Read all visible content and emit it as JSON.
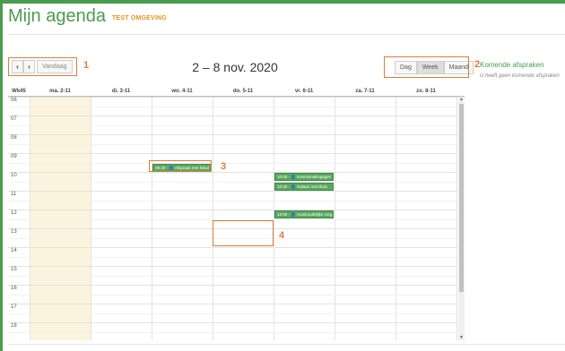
{
  "app": {
    "title": "Mijn agenda",
    "environment": "TEST OMGEVING",
    "accent": "#4a9c4e",
    "env_color": "#e8941a"
  },
  "toolbar": {
    "prev_icon": "chevron-left-icon",
    "prev_glyph": "‹",
    "next_icon": "chevron-right-icon",
    "next_glyph": "›",
    "today_label": "Vandaag",
    "date_range": "2 – 8 nov. 2020"
  },
  "views": [
    {
      "label": "Dag",
      "active": false
    },
    {
      "label": "Week",
      "active": true
    },
    {
      "label": "Maand",
      "active": false
    }
  ],
  "upcoming": {
    "title": "Komende afspraken",
    "empty_text": "U heeft geen komende afspraken"
  },
  "calendar": {
    "week_label": "Wk45",
    "days": [
      "ma. 2-11",
      "di. 3-11",
      "wo. 4-11",
      "do. 5-11",
      "vr. 6-11",
      "za. 7-11",
      "zo. 8-11"
    ],
    "today_index": 0,
    "today_color": "#fbf4dc",
    "hours": [
      "06",
      "07",
      "08",
      "09",
      "10",
      "11",
      "12",
      "13",
      "14",
      "15",
      "16",
      "17",
      "18"
    ],
    "events": [
      {
        "day": 2,
        "start": 9.5,
        "end": 10.0,
        "text": "09:30 - 👤 Afspraak met fiskal"
      },
      {
        "day": 4,
        "start": 10.0,
        "end": 10.5,
        "text": "10:00 - 👤 Kennismakingsges"
      },
      {
        "day": 4,
        "start": 10.5,
        "end": 11.0,
        "text": "10:30 - 👤 Nalaan met thuis"
      },
      {
        "day": 4,
        "start": 12.0,
        "end": 12.5,
        "text": "12:00 - 👤 Huishoudelijke zorg"
      }
    ],
    "event_color": "#5aa75e"
  },
  "annotations": [
    "1",
    "2",
    "3",
    "4"
  ],
  "annotation_color": "#e07b39"
}
